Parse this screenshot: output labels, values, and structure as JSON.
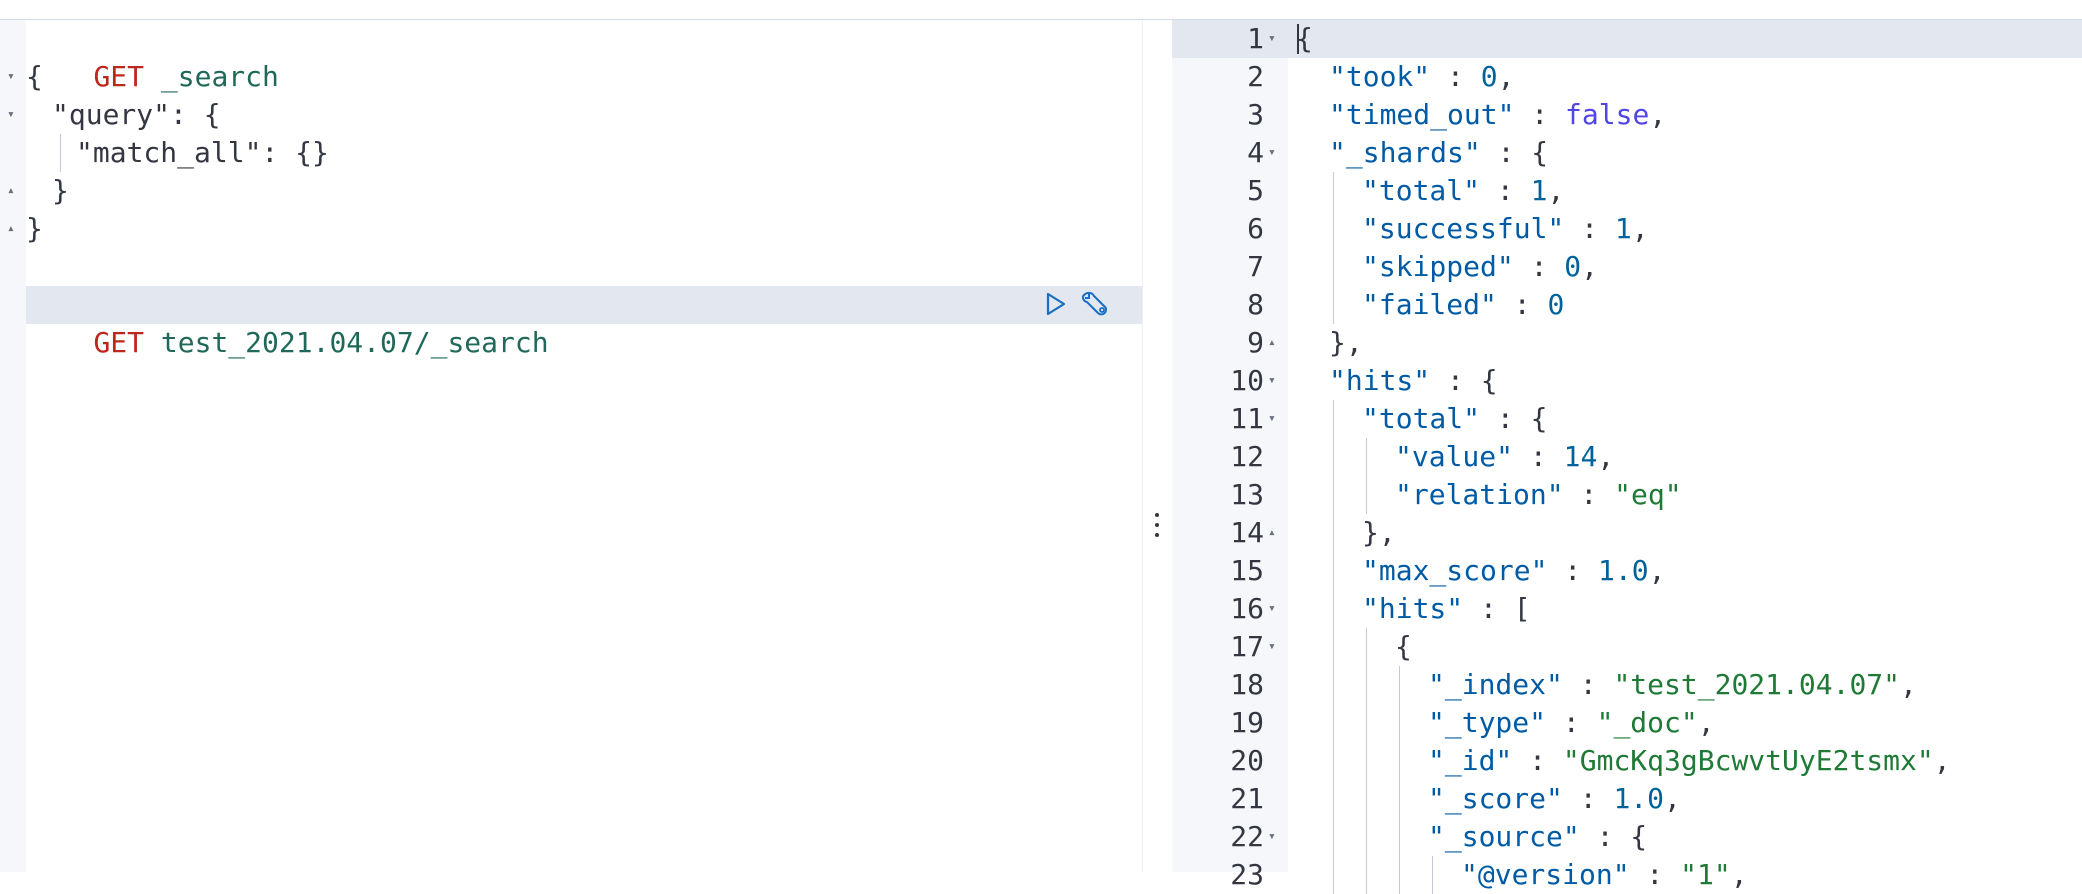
{
  "request": {
    "block1": {
      "method": "GET",
      "path": "_search",
      "lines": [
        "{",
        "\"query\": {",
        "\"match_all\": {}",
        "}",
        "}"
      ]
    },
    "block2": {
      "method": "GET",
      "path": "test_2021.04.07/_search"
    },
    "actions": {
      "run_icon": "play-icon",
      "settings_icon": "wrench-icon"
    }
  },
  "response": {
    "line_numbers": [
      "1",
      "2",
      "3",
      "4",
      "5",
      "6",
      "7",
      "8",
      "9",
      "10",
      "11",
      "12",
      "13",
      "14",
      "15",
      "16",
      "17",
      "18",
      "19",
      "20",
      "21",
      "22",
      "23"
    ],
    "lines": [
      "{",
      "\"took\" : 0,",
      "\"timed_out\" : false,",
      "\"_shards\" : {",
      "\"total\" : 1,",
      "\"successful\" : 1,",
      "\"skipped\" : 0,",
      "\"failed\" : 0",
      "},",
      "\"hits\" : {",
      "\"total\" : {",
      "\"value\" : 14,",
      "\"relation\" : \"eq\"",
      "},",
      "\"max_score\" : 1.0,",
      "\"hits\" : [",
      "{",
      "\"_index\" : \"test_2021.04.07\",",
      "\"_type\" : \"_doc\",",
      "\"_id\" : \"GmcKq3gBcwvtUyE2tsmx\",",
      "\"_score\" : 1.0,",
      "\"_source\" : {",
      "\"@version\" : \"1\","
    ]
  }
}
